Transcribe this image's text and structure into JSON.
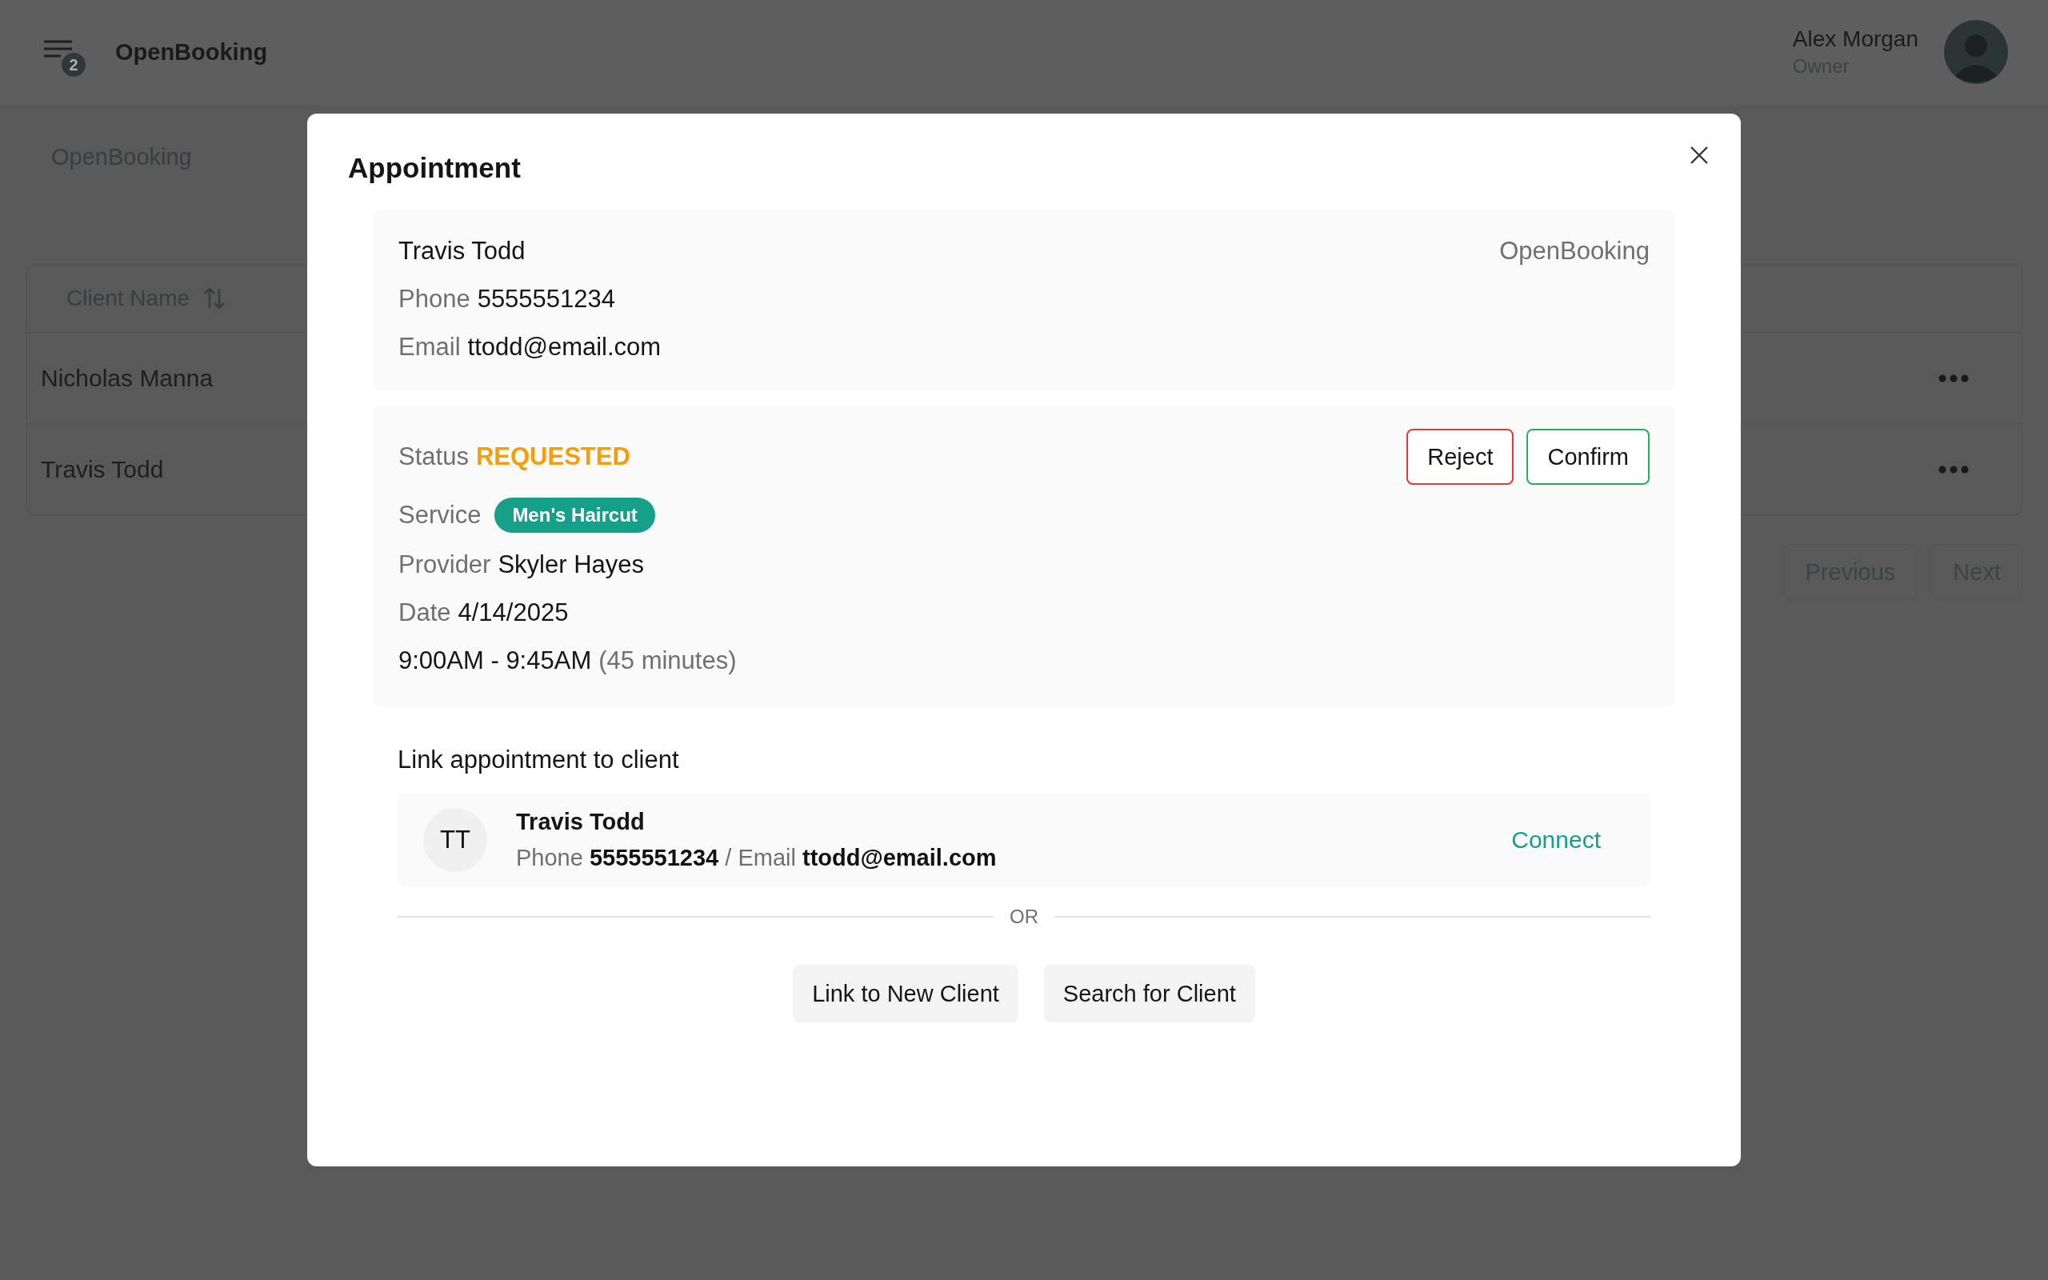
{
  "header": {
    "menu_badge": "2",
    "app_name": "OpenBooking",
    "user": {
      "name": "Alex Morgan",
      "role": "Owner"
    }
  },
  "breadcrumb": "OpenBooking",
  "table": {
    "columns": [
      "Client Name"
    ],
    "rows": [
      {
        "client_name": "Nicholas Manna"
      },
      {
        "client_name": "Travis Todd"
      }
    ]
  },
  "pagination": [
    "Previous",
    "Next"
  ],
  "modal": {
    "title": "Appointment",
    "contact": {
      "name": "Travis Todd",
      "source": "OpenBooking",
      "fields": [
        {
          "label": "Phone",
          "value": "5555551234"
        },
        {
          "label": "Email",
          "value": "ttodd@email.com"
        }
      ]
    },
    "details": {
      "status": {
        "label": "Status",
        "value": "REQUESTED",
        "kind": "requested"
      },
      "actions": [
        {
          "label": "Reject",
          "kind": "reject"
        },
        {
          "label": "Confirm",
          "kind": "confirm"
        }
      ],
      "service": {
        "label": "Service",
        "tag": "Men's Haircut"
      },
      "fields": [
        {
          "label": "Provider",
          "value": "Skyler Hayes"
        },
        {
          "label": "Date",
          "value": "4/14/2025"
        }
      ],
      "time": {
        "range": "9:00AM - 9:45AM",
        "duration": "(45 minutes)"
      }
    },
    "link": {
      "heading": "Link appointment to client",
      "candidate": {
        "initials": "TT",
        "name": "Travis Todd",
        "detail": "Phone **5555551234** / Email **ttodd@email.com**",
        "action": "Connect"
      },
      "divider": "OR",
      "buttons": [
        "Link to New Client",
        "Search for Client"
      ]
    }
  }
}
